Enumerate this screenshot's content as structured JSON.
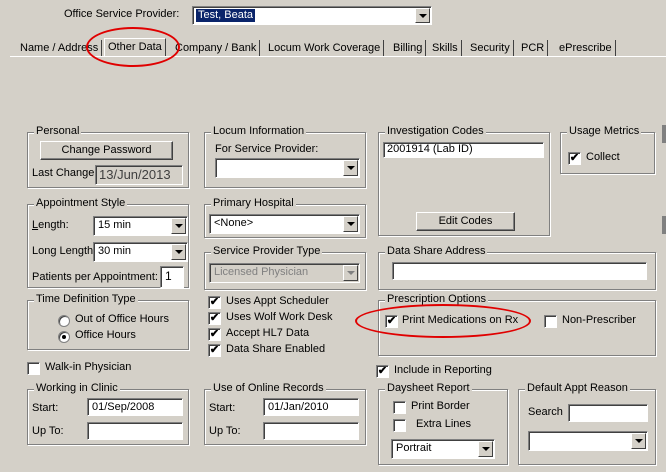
{
  "header": {
    "provider_label": "Office Service Provider:",
    "provider_value": "Test, Beata"
  },
  "tabs": [
    {
      "label": "Name / Address"
    },
    {
      "label": "Other Data"
    },
    {
      "label": "Company / Bank"
    },
    {
      "label": "Locum Work Coverage"
    },
    {
      "label": "Billing"
    },
    {
      "label": "Skills"
    },
    {
      "label": "Security"
    },
    {
      "label": "PCR"
    },
    {
      "label": "ePrescribe"
    }
  ],
  "personal": {
    "title": "Personal",
    "change_password": "Change Password",
    "last_change_label": "Last Change",
    "last_change_value": "13/Jun/2013"
  },
  "locum": {
    "title": "Locum Information",
    "for_label": "For Service Provider:",
    "for_value": ""
  },
  "investigation": {
    "title": "Investigation Codes",
    "code": "2001914  (Lab ID)",
    "edit_button": "Edit Codes"
  },
  "usage": {
    "title": "Usage Metrics",
    "collect_label": "Collect",
    "collect_checked": true
  },
  "appointment": {
    "title": "Appointment Style",
    "length_label": "Length:",
    "length_value": "15 min",
    "long_length_label": "Long Length:",
    "long_length_value": "30 min",
    "patients_label": "Patients per Appointment:",
    "patients_value": "1"
  },
  "hospital": {
    "title": "Primary Hospital",
    "value": "<None>"
  },
  "provider_type": {
    "title": "Service Provider Type",
    "value": "Licensed Physician"
  },
  "data_share": {
    "title": "Data Share Address",
    "value": ""
  },
  "time_def": {
    "title": "Time Definition Type",
    "options": [
      "Out of Office Hours",
      "Office Hours"
    ],
    "selected": "Office Hours"
  },
  "checks": {
    "appt_scheduler": "Uses Appt Scheduler",
    "wolf_desk": "Uses Wolf Work Desk",
    "hl7": "Accept HL7 Data",
    "data_share_enabled": "Data Share Enabled"
  },
  "prescription": {
    "title": "Prescription Options",
    "print_meds": "Print Medications on Rx",
    "non_prescriber": "Non-Prescriber"
  },
  "walkin": {
    "label": "Walk-in Physician"
  },
  "reporting": {
    "label": "Include in Reporting"
  },
  "clinic": {
    "title": "Working in Clinic",
    "start_label": "Start:",
    "start_value": "01/Sep/2008",
    "upto_label": "Up To:",
    "upto_value": ""
  },
  "online": {
    "title": "Use of Online Records",
    "start_label": "Start:",
    "start_value": "01/Jan/2010",
    "upto_label": "Up To:",
    "upto_value": ""
  },
  "daysheet": {
    "title": "Daysheet Report",
    "print_border": "Print Border",
    "extra_lines": "Extra Lines",
    "orientation": "Portrait"
  },
  "default_reason": {
    "title": "Default Appt Reason",
    "search_label": "Search",
    "search_value": "",
    "reason_value": ""
  },
  "colors": {
    "window_bg": "#d4d0c8",
    "selection_bg": "#0a246a",
    "annotation_red": "#e00000"
  }
}
